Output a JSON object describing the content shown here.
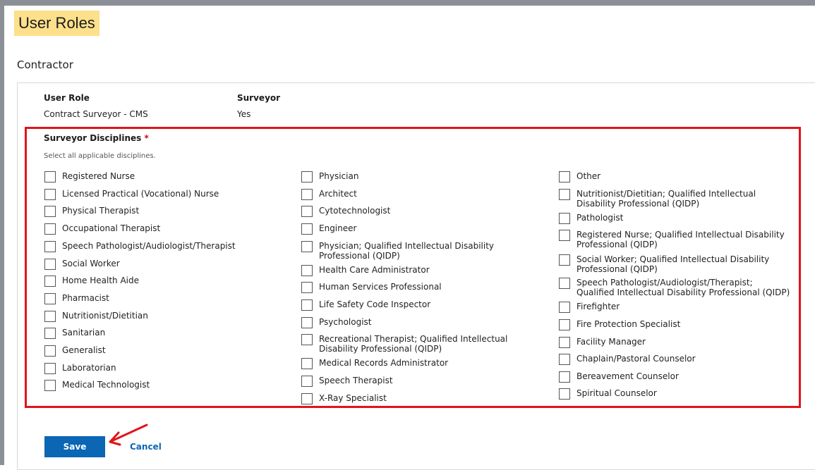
{
  "page": {
    "title": "User Roles"
  },
  "section": {
    "title": "Contractor"
  },
  "role_info": {
    "user_role_label": "User Role",
    "user_role_value": "Contract Surveyor - CMS",
    "surveyor_label": "Surveyor",
    "surveyor_value": "Yes"
  },
  "disciplines": {
    "title": "Surveyor Disciplines",
    "required_mark": "*",
    "hint": "Select all applicable disciplines.",
    "columns": [
      [
        "Registered Nurse",
        "Licensed Practical (Vocational) Nurse",
        "Physical Therapist",
        "Occupational Therapist",
        "Speech Pathologist/Audiologist/Therapist",
        "Social Worker",
        "Home Health Aide",
        "Pharmacist",
        "Nutritionist/Dietitian",
        "Sanitarian",
        "Generalist",
        "Laboratorian",
        "Medical Technologist"
      ],
      [
        "Physician",
        "Architect",
        "Cytotechnologist",
        "Engineer",
        "Physician; Qualified Intellectual Disability Professional (QIDP)",
        "Health Care Administrator",
        "Human Services Professional",
        "Life Safety Code Inspector",
        "Psychologist",
        "Recreational Therapist; Qualified Intellectual Disability Professional (QIDP)",
        "Medical Records Administrator",
        "Speech Therapist",
        "X-Ray Specialist"
      ],
      [
        "Other",
        "Nutritionist/Dietitian; Qualified Intellectual Disability Professional (QIDP)",
        "Pathologist",
        "Registered Nurse; Qualified Intellectual Disability Professional (QIDP)",
        "Social Worker; Qualified Intellectual Disability Professional (QIDP)",
        "Speech Pathologist/Audiologist/Therapist; Qualified Intellectual Disability Professional (QIDP)",
        "Firefighter",
        "Fire Protection Specialist",
        "Facility Manager",
        "Chaplain/Pastoral Counselor",
        "Bereavement Counselor",
        "Spiritual Counselor"
      ]
    ]
  },
  "actions": {
    "save_label": "Save",
    "cancel_label": "Cancel"
  },
  "colors": {
    "highlight": "#fde08b",
    "annotation_red": "#e1141b",
    "primary": "#0b66b4"
  }
}
